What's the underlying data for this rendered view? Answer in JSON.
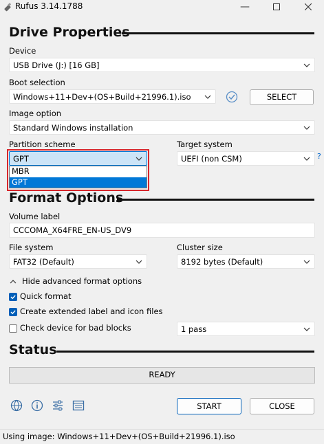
{
  "window": {
    "title": "Rufus 3.14.1788"
  },
  "drive_properties": {
    "heading": "Drive Properties",
    "device_label": "Device",
    "device_value": "USB Drive (J:) [16 GB]",
    "boot_label": "Boot selection",
    "boot_value": "Windows+11+Dev+(OS+Build+21996.1).iso",
    "select_button": "SELECT",
    "image_option_label": "Image option",
    "image_option_value": "Standard Windows installation",
    "partition_label": "Partition scheme",
    "partition_value": "GPT",
    "partition_options": [
      "MBR",
      "GPT"
    ],
    "target_label": "Target system",
    "target_value": "UEFI (non CSM)",
    "help_mark": "?"
  },
  "format_options": {
    "heading": "Format Options",
    "volume_label": "Volume label",
    "volume_value": "CCCOMA_X64FRE_EN-US_DV9",
    "fs_label": "File system",
    "fs_value": "FAT32 (Default)",
    "cluster_label": "Cluster size",
    "cluster_value": "8192 bytes (Default)",
    "advanced_toggle": "Hide advanced format options",
    "quick_format": "Quick format",
    "quick_format_checked": true,
    "extended_label": "Create extended label and icon files",
    "extended_label_checked": true,
    "bad_blocks": "Check device for bad blocks",
    "bad_blocks_checked": false,
    "passes_value": "1 pass"
  },
  "status": {
    "heading": "Status",
    "progress_text": "READY",
    "progress_fraction": 0
  },
  "actions": {
    "start": "START",
    "close": "CLOSE"
  },
  "statusbar": {
    "text": "Using image: Windows+11+Dev+(OS+Build+21996.1).iso"
  },
  "colors": {
    "accent": "#005fb8",
    "highlight_border": "#d7262c",
    "selection": "#0078d7"
  }
}
